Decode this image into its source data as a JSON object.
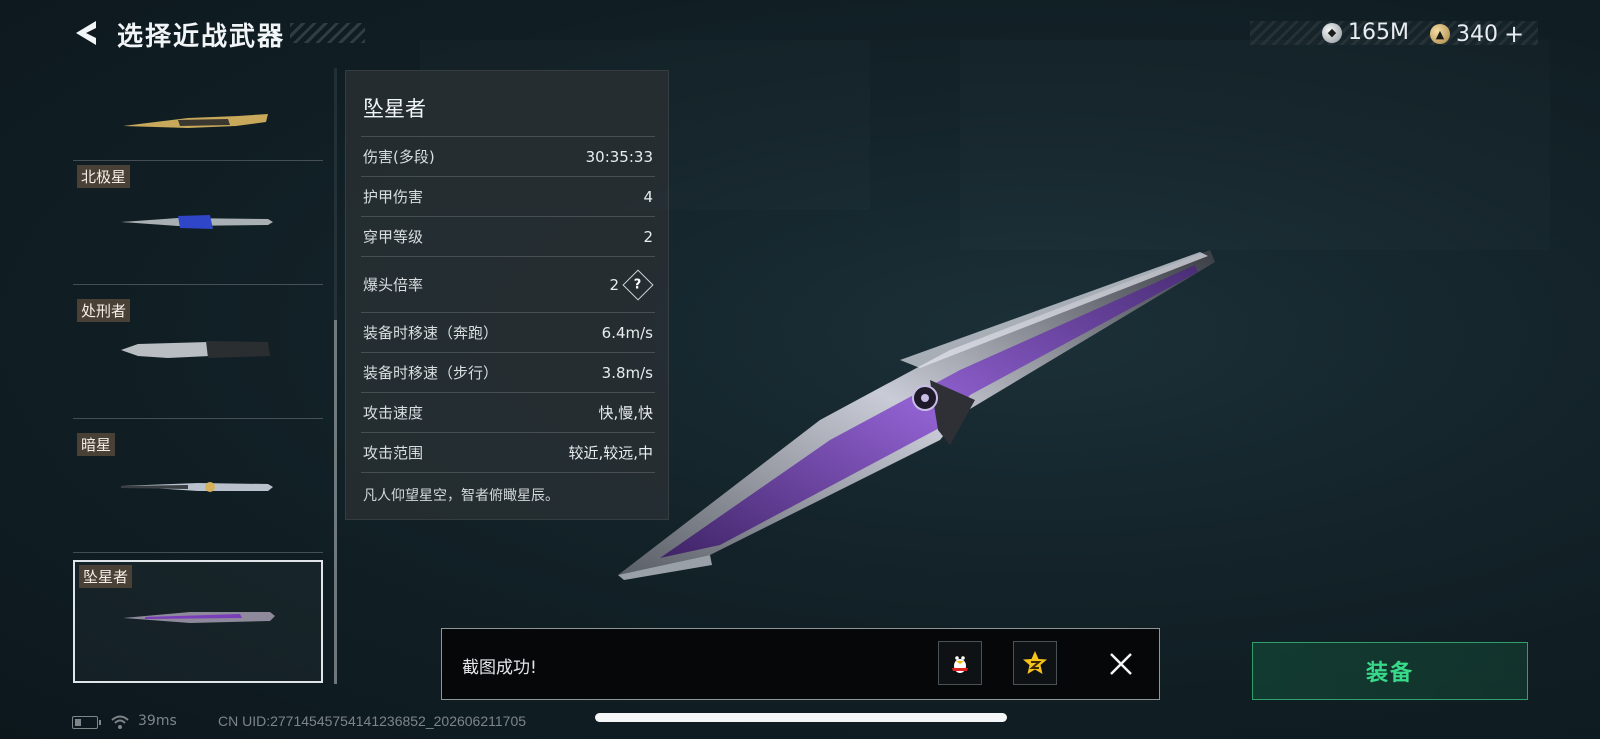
{
  "header": {
    "title": "选择近战武器"
  },
  "currency": {
    "silver_amount": "165M",
    "gold_amount": "340",
    "plus_label": "+"
  },
  "weapon_list": {
    "items": [
      {
        "label": "",
        "selected": false
      },
      {
        "label": "北极星",
        "selected": false
      },
      {
        "label": "处刑者",
        "selected": false
      },
      {
        "label": "暗星",
        "selected": false
      },
      {
        "label": "坠星者",
        "selected": true
      }
    ]
  },
  "stats": {
    "weapon_name": "坠星者",
    "rows": [
      {
        "name": "伤害(多段)",
        "value": "30:35:33"
      },
      {
        "name": "护甲伤害",
        "value": "4"
      },
      {
        "name": "穿甲等级",
        "value": "2"
      },
      {
        "name": "爆头倍率",
        "value": "2",
        "help": "?"
      },
      {
        "name": "装备时移速（奔跑）",
        "value": "6.4m/s"
      },
      {
        "name": "装备时移速（步行）",
        "value": "3.8m/s"
      },
      {
        "name": "攻击速度",
        "value": "快,慢,快"
      },
      {
        "name": "攻击范围",
        "value": "较近,较远,中"
      }
    ],
    "description": "凡人仰望星空，智者俯瞰星辰。"
  },
  "toast": {
    "message": "截图成功!"
  },
  "equip_button": {
    "label": "装备"
  },
  "status_bar": {
    "ping": "39ms",
    "uid": "CN UID:27714545754141236852_202606211705"
  },
  "colors": {
    "accent_green": "#39d98a",
    "purple_blade": "#7a3fb8"
  }
}
